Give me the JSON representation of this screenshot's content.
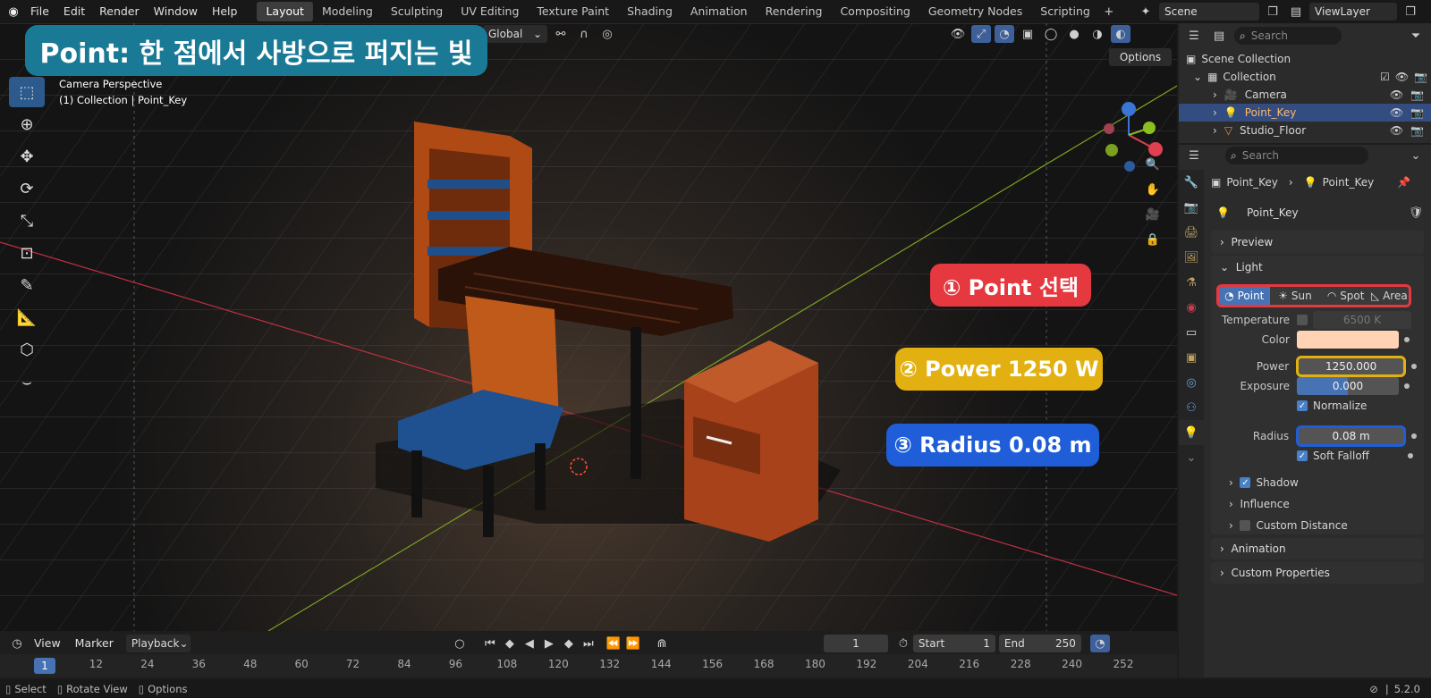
{
  "menu": [
    "File",
    "Edit",
    "Render",
    "Window",
    "Help"
  ],
  "workspaces": [
    "Layout",
    "Modeling",
    "Sculpting",
    "UV Editing",
    "Texture Paint",
    "Shading",
    "Animation",
    "Rendering",
    "Compositing",
    "Geometry Nodes",
    "Scripting"
  ],
  "active_workspace": "Layout",
  "scene": "Scene",
  "view_layer": "ViewLayer",
  "viewport": {
    "transform_orientation": "Global",
    "options_label": "Options",
    "perspective_text": "Camera Perspective",
    "collection_text": "(1) Collection | Point_Key"
  },
  "banner": "Point: 한 점에서 사방으로 퍼지는 빛",
  "callouts": {
    "c1": "① Point 선택",
    "c2": "② Power 1250 W",
    "c3": "③ Radius 0.08 m"
  },
  "colors": {
    "callout1": "#e5383f",
    "callout2": "#e2b010",
    "callout3": "#1f5ed8",
    "banner": "#1a7a96",
    "accent": "#4772b3",
    "light_color": "#ffd3b4"
  },
  "outliner": {
    "search_placeholder": "Search",
    "scene_collection": "Scene Collection",
    "collection": "Collection",
    "items": [
      {
        "name": "Camera",
        "icon": "camera-icon"
      },
      {
        "name": "Point_Key",
        "icon": "light-icon",
        "selected": true
      },
      {
        "name": "Studio_Floor",
        "icon": "mesh-icon"
      }
    ]
  },
  "properties": {
    "search_placeholder": "Search",
    "breadcrumb": [
      "Point_Key",
      "Point_Key"
    ],
    "datablock": "Point_Key",
    "panels": {
      "preview": "Preview",
      "light": "Light",
      "animation": "Animation",
      "custom_properties": "Custom Properties"
    },
    "light_types": [
      "Point",
      "Sun",
      "Spot",
      "Area"
    ],
    "active_light_type": "Point",
    "temperature_label": "Temperature",
    "temperature_value": "6500 K",
    "color_label": "Color",
    "power_label": "Power",
    "power_value": "1250.000",
    "exposure_label": "Exposure",
    "exposure_value": "0.000",
    "normalize_label": "Normalize",
    "radius_label": "Radius",
    "radius_value": "0.08 m",
    "soft_falloff_label": "Soft Falloff",
    "subpanels": [
      "Shadow",
      "Influence",
      "Custom Distance"
    ]
  },
  "timeline": {
    "view": "View",
    "marker": "Marker",
    "playback": "Playback",
    "current_frame": "1",
    "start_label": "Start",
    "start": "1",
    "end_label": "End",
    "end": "250",
    "ruler": [
      "1",
      "12",
      "24",
      "36",
      "48",
      "60",
      "72",
      "84",
      "96",
      "108",
      "120",
      "132",
      "144",
      "156",
      "168",
      "180",
      "192",
      "204",
      "216",
      "228",
      "240",
      "252"
    ]
  },
  "status": {
    "select": "Select",
    "rotate": "Rotate View",
    "options": "Options",
    "version": "5.2.0"
  }
}
